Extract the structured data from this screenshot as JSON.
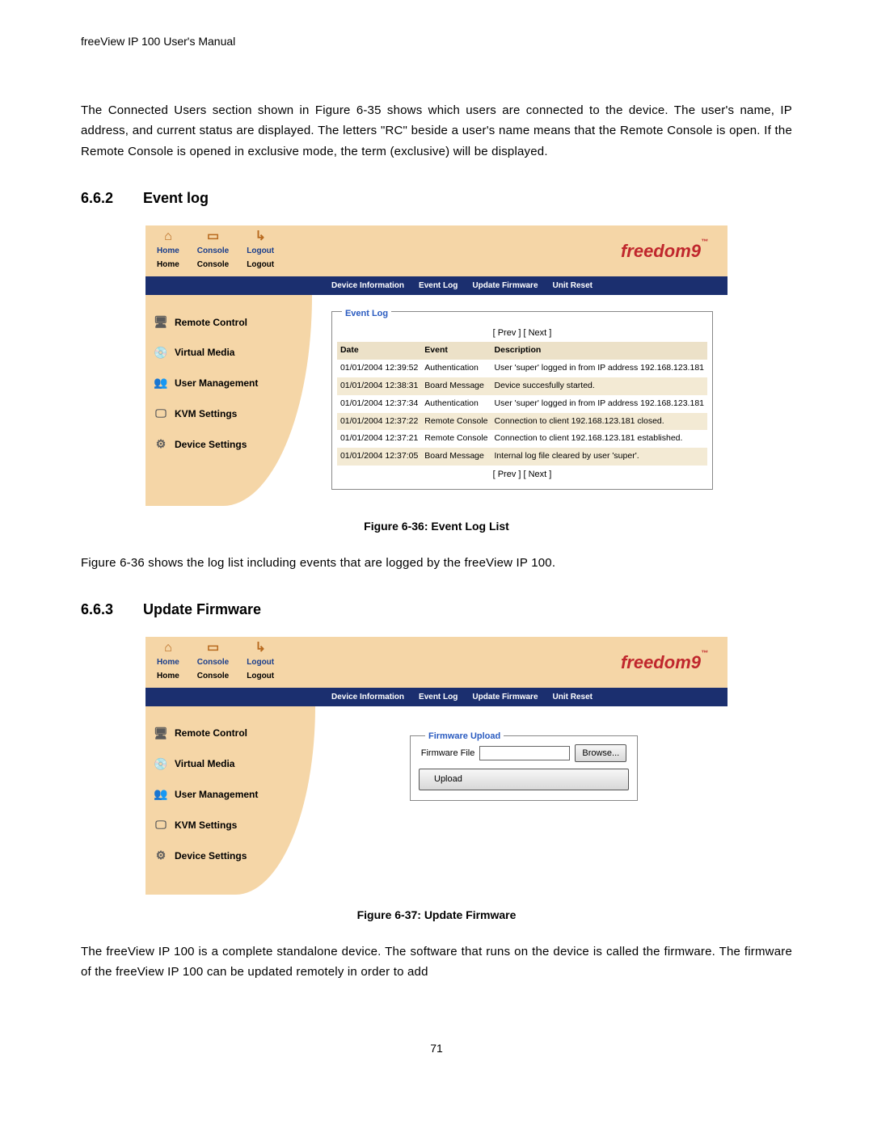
{
  "header": "freeView IP 100 User's Manual",
  "intro_para": "The Connected Users section shown in Figure 6-35 shows which users are connected to the device. The user's name, IP address, and current status are displayed. The letters \"RC\" beside a user's name means that the Remote Console is open. If the Remote Console is opened in exclusive mode, the term (exclusive) will be displayed.",
  "sec662": {
    "num": "6.6.2",
    "title": "Event log"
  },
  "sec663": {
    "num": "6.6.3",
    "title": "Update Firmware"
  },
  "caption36": "Figure 6-36: Event Log List",
  "caption37": "Figure 6-37: Update Firmware",
  "after36": "Figure 6-36 shows the log list including events that are logged by the freeView IP 100.",
  "after37": "The freeView IP 100 is a complete standalone device. The software that runs on the device is called the firmware. The firmware of the freeView IP 100 can be updated remotely in order to add",
  "page_number": "71",
  "top_icons": [
    {
      "small": "Home",
      "big": "Home",
      "glyph": "⌂"
    },
    {
      "small": "Console",
      "big": "Console",
      "glyph": "▭"
    },
    {
      "small": "Logout",
      "big": "Logout",
      "glyph": "↳"
    }
  ],
  "brand": "freedom9",
  "tabs": [
    "Device Information",
    "Event Log",
    "Update Firmware",
    "Unit Reset"
  ],
  "sidebar": [
    {
      "label": "Remote Control",
      "glyph": "🖥"
    },
    {
      "label": "Virtual Media",
      "glyph": "💿"
    },
    {
      "label": "User Management",
      "glyph": "👥"
    },
    {
      "label": "KVM Settings",
      "glyph": "🖵"
    },
    {
      "label": "Device Settings",
      "glyph": "⚙"
    }
  ],
  "eventlog": {
    "legend": "Event Log",
    "prev": "[ Prev ]",
    "next": "[ Next ]",
    "cols": {
      "date": "Date",
      "event": "Event",
      "desc": "Description"
    },
    "rows": [
      {
        "date": "01/01/2004 12:39:52",
        "event": "Authentication",
        "desc": "User 'super' logged in from IP address 192.168.123.181"
      },
      {
        "date": "01/01/2004 12:38:31",
        "event": "Board Message",
        "desc": "Device succesfully started."
      },
      {
        "date": "01/01/2004 12:37:34",
        "event": "Authentication",
        "desc": "User 'super' logged in from IP address 192.168.123.181"
      },
      {
        "date": "01/01/2004 12:37:22",
        "event": "Remote Console",
        "desc": "Connection to client 192.168.123.181 closed."
      },
      {
        "date": "01/01/2004 12:37:21",
        "event": "Remote Console",
        "desc": "Connection to client 192.168.123.181 established."
      },
      {
        "date": "01/01/2004 12:37:05",
        "event": "Board Message",
        "desc": "Internal log file cleared by user 'super'."
      }
    ]
  },
  "firmware": {
    "legend": "Firmware Upload",
    "label": "Firmware File",
    "browse": "Browse...",
    "upload": "Upload"
  }
}
